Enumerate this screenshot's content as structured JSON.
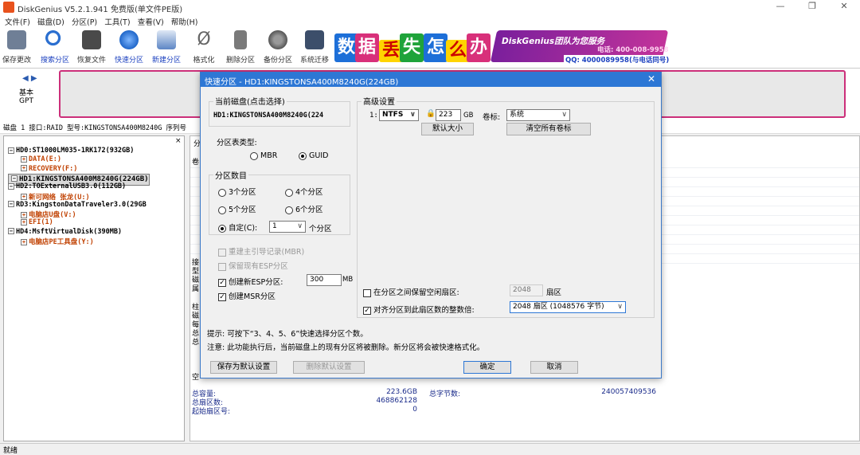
{
  "app": {
    "title": "DiskGenius V5.2.1.941 免费版(单文件PE版)"
  },
  "menu": [
    "文件(F)",
    "磁盘(D)",
    "分区(P)",
    "工具(T)",
    "查看(V)",
    "帮助(H)"
  ],
  "toolbar": [
    {
      "label": "保存更改",
      "icon": "save-icon",
      "active": false
    },
    {
      "label": "搜索分区",
      "icon": "search-icon",
      "active": true
    },
    {
      "label": "恢复文件",
      "icon": "recover-icon",
      "active": false
    },
    {
      "label": "快速分区",
      "icon": "quick-partition-icon",
      "active": true
    },
    {
      "label": "新建分区",
      "icon": "new-partition-icon",
      "active": true
    },
    {
      "label": "格式化",
      "icon": "format-icon",
      "active": false
    },
    {
      "label": "删除分区",
      "icon": "delete-icon",
      "active": false
    },
    {
      "label": "备份分区",
      "icon": "backup-icon",
      "active": false
    },
    {
      "label": "系统迁移",
      "icon": "migrate-icon",
      "active": false
    }
  ],
  "banner": {
    "chars": [
      "数",
      "据",
      "丢",
      "失",
      "怎",
      "么",
      "办"
    ],
    "promo_brand": "DiskGenius团队为您服务",
    "promo_tel": "电话: 400-008-9958",
    "promo_qq": "QQ: 4000089958(与电话同号)"
  },
  "disk_map": {
    "basic_label": "基本",
    "style_label": "GPT"
  },
  "disk_info": "磁盘 1 接口:RAID 型号:KINGSTONSA400M8240G 序列号",
  "tree": [
    {
      "text": "HD0:ST1000LM035-1RK172(932GB)",
      "level": 0,
      "kind": "disk"
    },
    {
      "text": "DATA(E:)",
      "level": 1,
      "kind": "part"
    },
    {
      "text": "RECOVERY(F:)",
      "level": 1,
      "kind": "part"
    },
    {
      "text": "HD1:KINGSTONSA400M8240G(224GB)",
      "level": 0,
      "kind": "disk",
      "selected": true
    },
    {
      "text": "HD2:TOExternalUSB3.0(112GB)",
      "level": 0,
      "kind": "disk"
    },
    {
      "text": "新可网络 张龙(U:)",
      "level": 1,
      "kind": "part"
    },
    {
      "text": "RD3:KingstonDataTraveler3.0(29GB",
      "level": 0,
      "kind": "disk"
    },
    {
      "text": "电脑店U盘(V:)",
      "level": 1,
      "kind": "part"
    },
    {
      "text": "EFI(1)",
      "level": 1,
      "kind": "part"
    },
    {
      "text": "HD4:MsftVirtualDisk(390MB)",
      "level": 0,
      "kind": "disk"
    },
    {
      "text": "电脑店PE工具盘(Y:)",
      "level": 1,
      "kind": "part"
    }
  ],
  "right_pane": {
    "tab_text": "分",
    "side_labels": [
      "卷",
      "接",
      "型",
      "磁",
      "属",
      "柱",
      "磁",
      "每",
      "总",
      "总",
      "空"
    ],
    "total_capacity_label": "总容量:",
    "total_capacity_value": "223.6GB",
    "total_sectors_label": "总扇区数:",
    "total_sectors_value": "468862128",
    "start_sector_label": "起始扇区号:",
    "start_sector_value": "0",
    "total_bytes_label": "总字节数:",
    "total_bytes_value": "240057409536"
  },
  "status": "就绪",
  "dialog": {
    "title": "快速分区 - HD1:KINGSTONSA400M8240G(224GB)",
    "current_disk_label": "当前磁盘(点击选择)",
    "current_disk_value": "HD1:KINGSTONSA400M8240G(224",
    "table_type_label": "分区表类型:",
    "table_types": [
      {
        "label": "MBR",
        "selected": false
      },
      {
        "label": "GUID",
        "selected": true
      }
    ],
    "count_label": "分区数目",
    "count_options": [
      {
        "label": "3个分区",
        "selected": false
      },
      {
        "label": "4个分区",
        "selected": false
      },
      {
        "label": "5个分区",
        "selected": false
      },
      {
        "label": "6个分区",
        "selected": false
      }
    ],
    "custom_label": "自定(C):",
    "custom_value": "1",
    "custom_suffix": "个分区",
    "opt_rebuild_mbr": {
      "label": "重建主引导记录(MBR)",
      "checked": false,
      "disabled": true
    },
    "opt_keep_esp": {
      "label": "保留现有ESP分区",
      "checked": false,
      "disabled": true
    },
    "opt_new_esp": {
      "label": "创建新ESP分区:",
      "checked": true,
      "disabled": false
    },
    "esp_size": "300",
    "esp_unit": "MB",
    "opt_msr": {
      "label": "创建MSR分区",
      "checked": true,
      "disabled": false
    },
    "advanced_label": "高级设置",
    "adv_index": "1:",
    "adv_fs": "NTFS",
    "adv_size": "223",
    "adv_unit": "GB",
    "adv_vol_label": "卷标:",
    "adv_vol_value": "系统",
    "btn_default_size": "默认大小",
    "btn_clear_labels": "清空所有卷标",
    "opt_keep_free": {
      "label": "在分区之间保留空闲扇区:",
      "checked": false
    },
    "keep_free_value": "2048",
    "keep_free_unit": "扇区",
    "opt_align": {
      "label": "对齐分区到此扇区数的整数倍:",
      "checked": true
    },
    "align_value": "2048 扇区 (1048576 字节)",
    "hint1": "提示: 可按下“3、4、5、6”快速选择分区个数。",
    "hint2": "注意: 此功能执行后，当前磁盘上的现有分区将被删除。新分区将会被快速格式化。",
    "btn_save_default": "保存为默认设置",
    "btn_delete_default": "删除默认设置",
    "btn_ok": "确定",
    "btn_cancel": "取消"
  },
  "colors": {
    "accent": "#2d77d5",
    "partition_border": "#cc2f7a",
    "tree_part": "#c04000"
  }
}
